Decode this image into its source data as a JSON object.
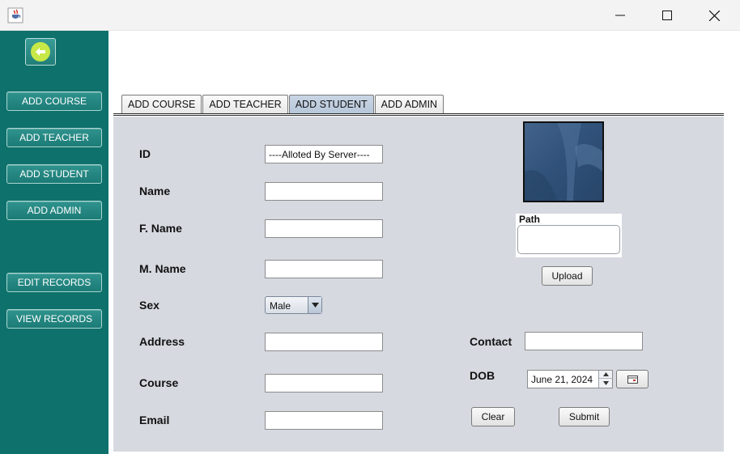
{
  "window": {
    "app_icon": "java-cup-icon",
    "controls": [
      "minimize-icon",
      "maximize-icon",
      "close-icon"
    ]
  },
  "sidebar": {
    "back_icon": "arrow-left-icon",
    "items": [
      {
        "label": "ADD COURSE"
      },
      {
        "label": "ADD TEACHER"
      },
      {
        "label": "ADD STUDENT"
      },
      {
        "label": "ADD ADMIN"
      },
      {
        "label": "EDIT RECORDS"
      },
      {
        "label": "VIEW RECORDS"
      }
    ],
    "colors": {
      "background": "#0f716c",
      "back_icon": "#c7e847"
    }
  },
  "tabs": [
    {
      "label": "ADD COURSE",
      "active": false
    },
    {
      "label": "ADD TEACHER",
      "active": false
    },
    {
      "label": "ADD STUDENT",
      "active": true
    },
    {
      "label": "ADD ADMIN",
      "active": false
    }
  ],
  "form": {
    "id": {
      "label": "ID",
      "value": "----Alloted By Server----"
    },
    "name": {
      "label": "Name",
      "value": ""
    },
    "fname": {
      "label": "F. Name",
      "value": ""
    },
    "mname": {
      "label": "M. Name",
      "value": ""
    },
    "sex": {
      "label": "Sex",
      "value": "Male"
    },
    "address": {
      "label": "Address",
      "value": ""
    },
    "course": {
      "label": "Course",
      "value": ""
    },
    "email": {
      "label": "Email",
      "value": ""
    },
    "contact": {
      "label": "Contact",
      "value": ""
    },
    "dob": {
      "label": "DOB",
      "value": "June 21, 2024"
    },
    "path": {
      "label": "Path",
      "value": ""
    },
    "upload_label": "Upload",
    "clear_label": "Clear",
    "submit_label": "Submit",
    "calendar_icon": "calendar-icon"
  }
}
